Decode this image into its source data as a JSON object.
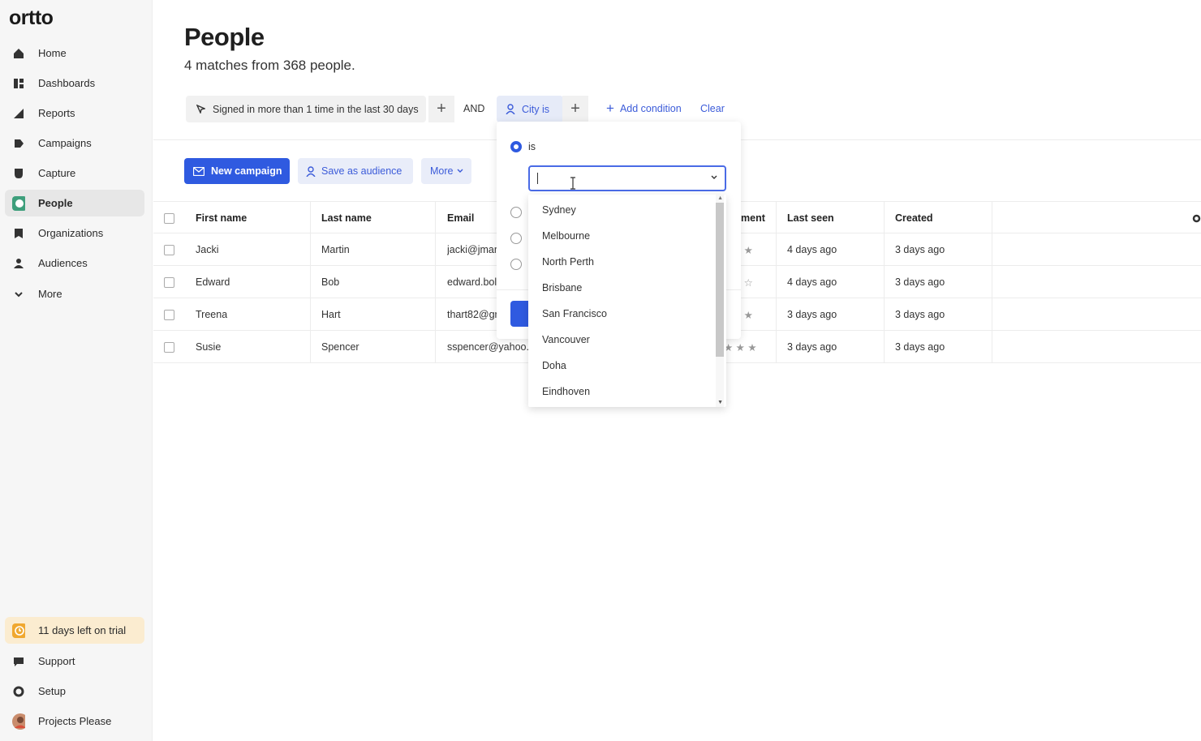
{
  "app": {
    "logo": "ortto"
  },
  "sidebar": {
    "items": [
      {
        "label": "Home",
        "icon": "home-icon"
      },
      {
        "label": "Dashboards",
        "icon": "dashboard-icon"
      },
      {
        "label": "Reports",
        "icon": "reports-icon"
      },
      {
        "label": "Campaigns",
        "icon": "campaigns-icon"
      },
      {
        "label": "Capture",
        "icon": "capture-icon"
      },
      {
        "label": "People",
        "icon": "people-icon",
        "active": true
      },
      {
        "label": "Organizations",
        "icon": "organizations-icon"
      },
      {
        "label": "Audiences",
        "icon": "audiences-icon"
      },
      {
        "label": "More",
        "icon": "chevron-down-icon"
      }
    ],
    "bottom": {
      "trial": "11 days left on trial",
      "support": "Support",
      "setup": "Setup",
      "account": "Projects Please"
    }
  },
  "page": {
    "title": "People",
    "subtitle": "4 matches from 368 people."
  },
  "filters": {
    "condition1": "Signed in more than 1 time in the last 30 days",
    "joiner": "AND",
    "condition2": "City is",
    "add_condition": "Add condition",
    "clear": "Clear"
  },
  "actions": {
    "new_campaign": "New campaign",
    "save_audience": "Save as audience",
    "more": "More"
  },
  "table": {
    "headers": [
      "First name",
      "Last name",
      "Email",
      "ment",
      "Last seen",
      "Created"
    ],
    "rows": [
      {
        "first": "Jacki",
        "last": "Martin",
        "email": "jacki@jmar",
        "seen": "4 days ago",
        "created": "3 days ago"
      },
      {
        "first": "Edward",
        "last": "Bob",
        "email": "edward.bol",
        "seen": "4 days ago",
        "created": "3 days ago"
      },
      {
        "first": "Treena",
        "last": "Hart",
        "email": "thart82@gr",
        "seen": "3 days ago",
        "created": "3 days ago"
      },
      {
        "first": "Susie",
        "last": "Spencer",
        "email": "sspencer@yahoo.",
        "seen": "3 days ago",
        "created": "3 days ago"
      }
    ]
  },
  "popover": {
    "radio_is": "is",
    "combo_value": "",
    "options": [
      "Sydney",
      "Melbourne",
      "North Perth",
      "Brisbane",
      "San Francisco",
      "Vancouver",
      "Doha",
      "Eindhoven"
    ]
  },
  "colors": {
    "accent": "#2f5ae0",
    "link": "#3b5bd9",
    "trial_bg": "#fbecd0"
  }
}
